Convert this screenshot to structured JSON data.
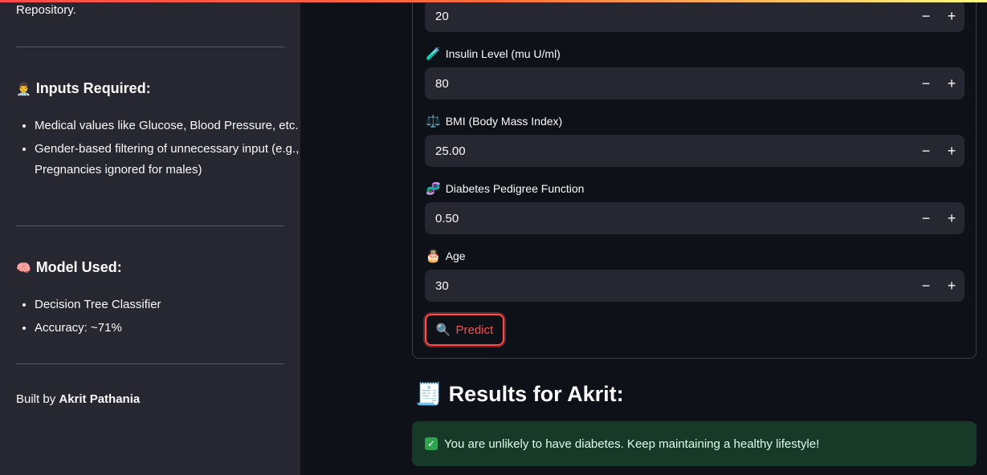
{
  "sidebar": {
    "repo_text": "Repository.",
    "inputs_heading": "Inputs Required:",
    "inputs_icon": "👨‍⚕️",
    "inputs_items": [
      "Medical values like Glucose, Blood Pressure, etc.",
      "Gender-based filtering of unnecessary input (e.g., Pregnancies ignored for males)"
    ],
    "model_heading": "Model Used:",
    "model_icon": "🧠",
    "model_items": [
      "Decision Tree Classifier",
      "Accuracy: ~71%"
    ],
    "built_by_prefix": "Built by ",
    "built_by_name": "Akrit Pathania"
  },
  "form": {
    "skin_value": "20",
    "fields": [
      {
        "label": "Insulin Level (mu U/ml)",
        "icon": "🧪",
        "value": "80"
      },
      {
        "label": "BMI (Body Mass Index)",
        "icon": "⚖️",
        "value": "25.00"
      },
      {
        "label": "Diabetes Pedigree Function",
        "icon": "🧬",
        "value": "0.50"
      },
      {
        "label": "Age",
        "icon": "🎂",
        "value": "30"
      }
    ],
    "minus": "−",
    "plus": "+",
    "predict_icon": "🔍",
    "predict_label": "Predict"
  },
  "results": {
    "icon": "🧾",
    "title": "Results for Akrit:",
    "message": "You are unlikely to have diabetes. Keep maintaining a healthy lifestyle!",
    "check": "✓"
  },
  "colors": {
    "accent": "#ff4b4b",
    "success_bg": "#173928",
    "sidebar_bg": "#262730",
    "main_bg": "#0e1117"
  }
}
